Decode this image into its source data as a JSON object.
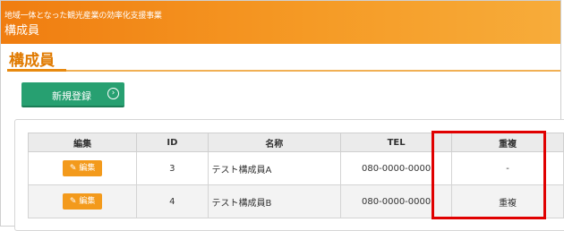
{
  "header": {
    "subtitle": "地域一体となった観光産業の効率化支援事業",
    "title": "構成員"
  },
  "page": {
    "title": "構成員"
  },
  "actions": {
    "new_label": "新規登録",
    "new_icon": "chevron-right-circle-icon"
  },
  "table": {
    "columns": [
      "編集",
      "ID",
      "名称",
      "TEL",
      "重複"
    ],
    "rows": [
      {
        "edit": "編集",
        "id": "3",
        "name": "テスト構成員A",
        "tel": "080-0000-0000",
        "dup": "-"
      },
      {
        "edit": "編集",
        "id": "4",
        "name": "テスト構成員B",
        "tel": "080-0000-0000",
        "dup": "重複"
      }
    ]
  },
  "colors": {
    "header_orange": "#f59a25",
    "button_green": "#27a071",
    "edit_orange": "#f39a1c",
    "highlight_red": "#e00000"
  }
}
